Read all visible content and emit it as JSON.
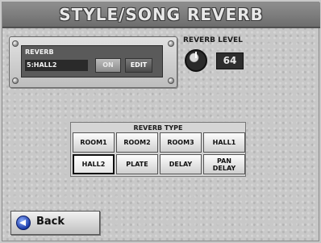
{
  "title": "STYLE/SONG REVERB",
  "reverb_panel": {
    "label": "REVERB",
    "value": "5:HALL2",
    "on_label": "ON",
    "edit_label": "EDIT"
  },
  "reverb_level": {
    "label": "REVERB LEVEL",
    "value": "64"
  },
  "reverb_type": {
    "title": "REVERB TYPE",
    "selected": "HALL2",
    "buttons": [
      "ROOM1",
      "ROOM2",
      "ROOM3",
      "HALL1",
      "HALL2",
      "PLATE",
      "DELAY",
      "PAN\nDELAY"
    ]
  },
  "back_button": {
    "label": "Back"
  }
}
